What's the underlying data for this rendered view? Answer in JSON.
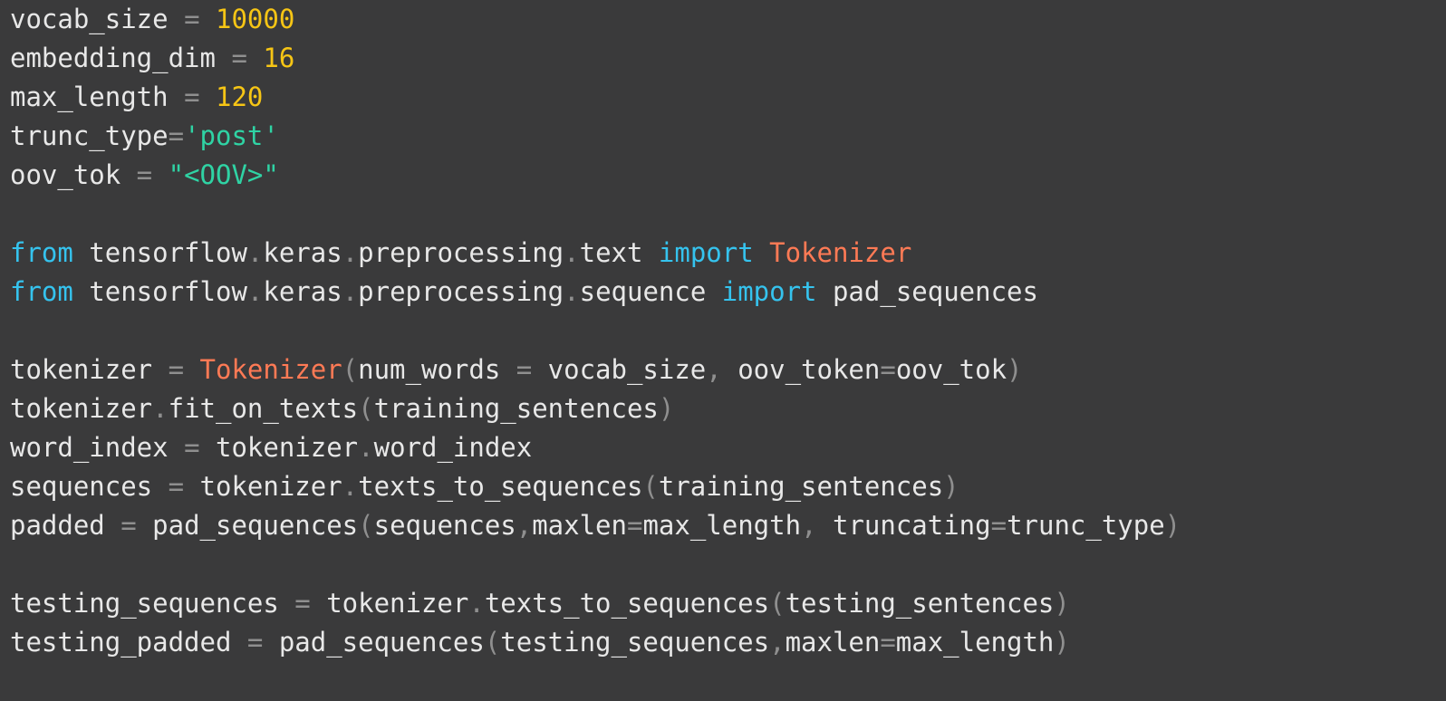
{
  "theme": {
    "background": "#3a3a3b",
    "plain": "#e8e8e8",
    "punctuation": "#8f8f8f",
    "number": "#f6c515",
    "string": "#2fd3a4",
    "keyword": "#35c3ee",
    "class": "#ff7a55"
  },
  "code": {
    "lines": [
      {
        "tokens": [
          {
            "t": "vocab_size",
            "c": "plain"
          },
          {
            "t": " = ",
            "c": "punct"
          },
          {
            "t": "10000",
            "c": "num"
          }
        ]
      },
      {
        "tokens": [
          {
            "t": "embedding_dim",
            "c": "plain"
          },
          {
            "t": " = ",
            "c": "punct"
          },
          {
            "t": "16",
            "c": "num"
          }
        ]
      },
      {
        "tokens": [
          {
            "t": "max_length",
            "c": "plain"
          },
          {
            "t": " = ",
            "c": "punct"
          },
          {
            "t": "120",
            "c": "num"
          }
        ]
      },
      {
        "tokens": [
          {
            "t": "trunc_type",
            "c": "plain"
          },
          {
            "t": "=",
            "c": "punct"
          },
          {
            "t": "'post'",
            "c": "str"
          }
        ]
      },
      {
        "tokens": [
          {
            "t": "oov_tok",
            "c": "plain"
          },
          {
            "t": " = ",
            "c": "punct"
          },
          {
            "t": "\"<OOV>\"",
            "c": "str"
          }
        ]
      },
      {
        "tokens": []
      },
      {
        "tokens": [
          {
            "t": "from",
            "c": "kw"
          },
          {
            "t": " tensorflow",
            "c": "plain"
          },
          {
            "t": ".",
            "c": "punct"
          },
          {
            "t": "keras",
            "c": "plain"
          },
          {
            "t": ".",
            "c": "punct"
          },
          {
            "t": "preprocessing",
            "c": "plain"
          },
          {
            "t": ".",
            "c": "punct"
          },
          {
            "t": "text ",
            "c": "plain"
          },
          {
            "t": "import",
            "c": "kw"
          },
          {
            "t": " ",
            "c": "plain"
          },
          {
            "t": "Tokenizer",
            "c": "cls"
          }
        ]
      },
      {
        "tokens": [
          {
            "t": "from",
            "c": "kw"
          },
          {
            "t": " tensorflow",
            "c": "plain"
          },
          {
            "t": ".",
            "c": "punct"
          },
          {
            "t": "keras",
            "c": "plain"
          },
          {
            "t": ".",
            "c": "punct"
          },
          {
            "t": "preprocessing",
            "c": "plain"
          },
          {
            "t": ".",
            "c": "punct"
          },
          {
            "t": "sequence ",
            "c": "plain"
          },
          {
            "t": "import",
            "c": "kw"
          },
          {
            "t": " pad_sequences",
            "c": "plain"
          }
        ]
      },
      {
        "tokens": []
      },
      {
        "tokens": [
          {
            "t": "tokenizer",
            "c": "plain"
          },
          {
            "t": " = ",
            "c": "punct"
          },
          {
            "t": "Tokenizer",
            "c": "cls"
          },
          {
            "t": "(",
            "c": "punct"
          },
          {
            "t": "num_words",
            "c": "plain"
          },
          {
            "t": " = ",
            "c": "punct"
          },
          {
            "t": "vocab_size",
            "c": "plain"
          },
          {
            "t": ", ",
            "c": "punct"
          },
          {
            "t": "oov_token",
            "c": "plain"
          },
          {
            "t": "=",
            "c": "punct"
          },
          {
            "t": "oov_tok",
            "c": "plain"
          },
          {
            "t": ")",
            "c": "punct"
          }
        ]
      },
      {
        "tokens": [
          {
            "t": "tokenizer",
            "c": "plain"
          },
          {
            "t": ".",
            "c": "punct"
          },
          {
            "t": "fit_on_texts",
            "c": "plain"
          },
          {
            "t": "(",
            "c": "punct"
          },
          {
            "t": "training_sentences",
            "c": "plain"
          },
          {
            "t": ")",
            "c": "punct"
          }
        ]
      },
      {
        "tokens": [
          {
            "t": "word_index",
            "c": "plain"
          },
          {
            "t": " = ",
            "c": "punct"
          },
          {
            "t": "tokenizer",
            "c": "plain"
          },
          {
            "t": ".",
            "c": "punct"
          },
          {
            "t": "word_index",
            "c": "plain"
          }
        ]
      },
      {
        "tokens": [
          {
            "t": "sequences",
            "c": "plain"
          },
          {
            "t": " = ",
            "c": "punct"
          },
          {
            "t": "tokenizer",
            "c": "plain"
          },
          {
            "t": ".",
            "c": "punct"
          },
          {
            "t": "texts_to_sequences",
            "c": "plain"
          },
          {
            "t": "(",
            "c": "punct"
          },
          {
            "t": "training_sentences",
            "c": "plain"
          },
          {
            "t": ")",
            "c": "punct"
          }
        ]
      },
      {
        "tokens": [
          {
            "t": "padded",
            "c": "plain"
          },
          {
            "t": " = ",
            "c": "punct"
          },
          {
            "t": "pad_sequences",
            "c": "plain"
          },
          {
            "t": "(",
            "c": "punct"
          },
          {
            "t": "sequences",
            "c": "plain"
          },
          {
            "t": ",",
            "c": "punct"
          },
          {
            "t": "maxlen",
            "c": "plain"
          },
          {
            "t": "=",
            "c": "punct"
          },
          {
            "t": "max_length",
            "c": "plain"
          },
          {
            "t": ", ",
            "c": "punct"
          },
          {
            "t": "truncating",
            "c": "plain"
          },
          {
            "t": "=",
            "c": "punct"
          },
          {
            "t": "trunc_type",
            "c": "plain"
          },
          {
            "t": ")",
            "c": "punct"
          }
        ]
      },
      {
        "tokens": []
      },
      {
        "tokens": [
          {
            "t": "testing_sequences",
            "c": "plain"
          },
          {
            "t": " = ",
            "c": "punct"
          },
          {
            "t": "tokenizer",
            "c": "plain"
          },
          {
            "t": ".",
            "c": "punct"
          },
          {
            "t": "texts_to_sequences",
            "c": "plain"
          },
          {
            "t": "(",
            "c": "punct"
          },
          {
            "t": "testing_sentences",
            "c": "plain"
          },
          {
            "t": ")",
            "c": "punct"
          }
        ]
      },
      {
        "tokens": [
          {
            "t": "testing_padded",
            "c": "plain"
          },
          {
            "t": " = ",
            "c": "punct"
          },
          {
            "t": "pad_sequences",
            "c": "plain"
          },
          {
            "t": "(",
            "c": "punct"
          },
          {
            "t": "testing_sequences",
            "c": "plain"
          },
          {
            "t": ",",
            "c": "punct"
          },
          {
            "t": "maxlen",
            "c": "plain"
          },
          {
            "t": "=",
            "c": "punct"
          },
          {
            "t": "max_length",
            "c": "plain"
          },
          {
            "t": ")",
            "c": "punct"
          }
        ]
      }
    ]
  }
}
